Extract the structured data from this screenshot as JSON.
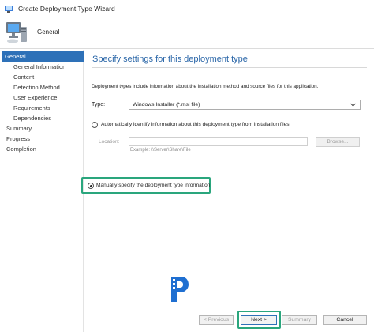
{
  "window": {
    "title": "Create Deployment Type Wizard"
  },
  "header": {
    "page_title": "General"
  },
  "nav": {
    "items": [
      {
        "label": "General",
        "selected": true
      },
      {
        "label": "General Information"
      },
      {
        "label": "Content"
      },
      {
        "label": "Detection Method"
      },
      {
        "label": "User Experience"
      },
      {
        "label": "Requirements"
      },
      {
        "label": "Dependencies"
      },
      {
        "label": "Summary"
      },
      {
        "label": "Progress"
      },
      {
        "label": "Completion"
      }
    ]
  },
  "main": {
    "heading": "Specify settings for this deployment type",
    "description": "Deployment types include information about the installation method and source files for this application.",
    "type_label": "Type:",
    "type_value": "Windows Installer (*.msi file)",
    "auto_option_label": "Automatically identify information about this deployment type from installation files",
    "location_label": "Location:",
    "location_value": "",
    "browse_label": "Browse...",
    "example_text": "Example: \\\\Server\\Share\\File",
    "manual_option_label": "Manually specify the deployment type information",
    "manual_selected": true
  },
  "buttons": {
    "previous": "< Previous",
    "next": "Next >",
    "summary": "Summary",
    "cancel": "Cancel"
  },
  "colors": {
    "accent": "#2e71b8",
    "heading": "#2a66a8",
    "highlight": "#2aa67d"
  },
  "icons": {
    "app": "wizard-app-icon",
    "header": "computer-monitor-icon",
    "dropdown": "chevron-down-icon",
    "logo": "watermark-logo"
  }
}
